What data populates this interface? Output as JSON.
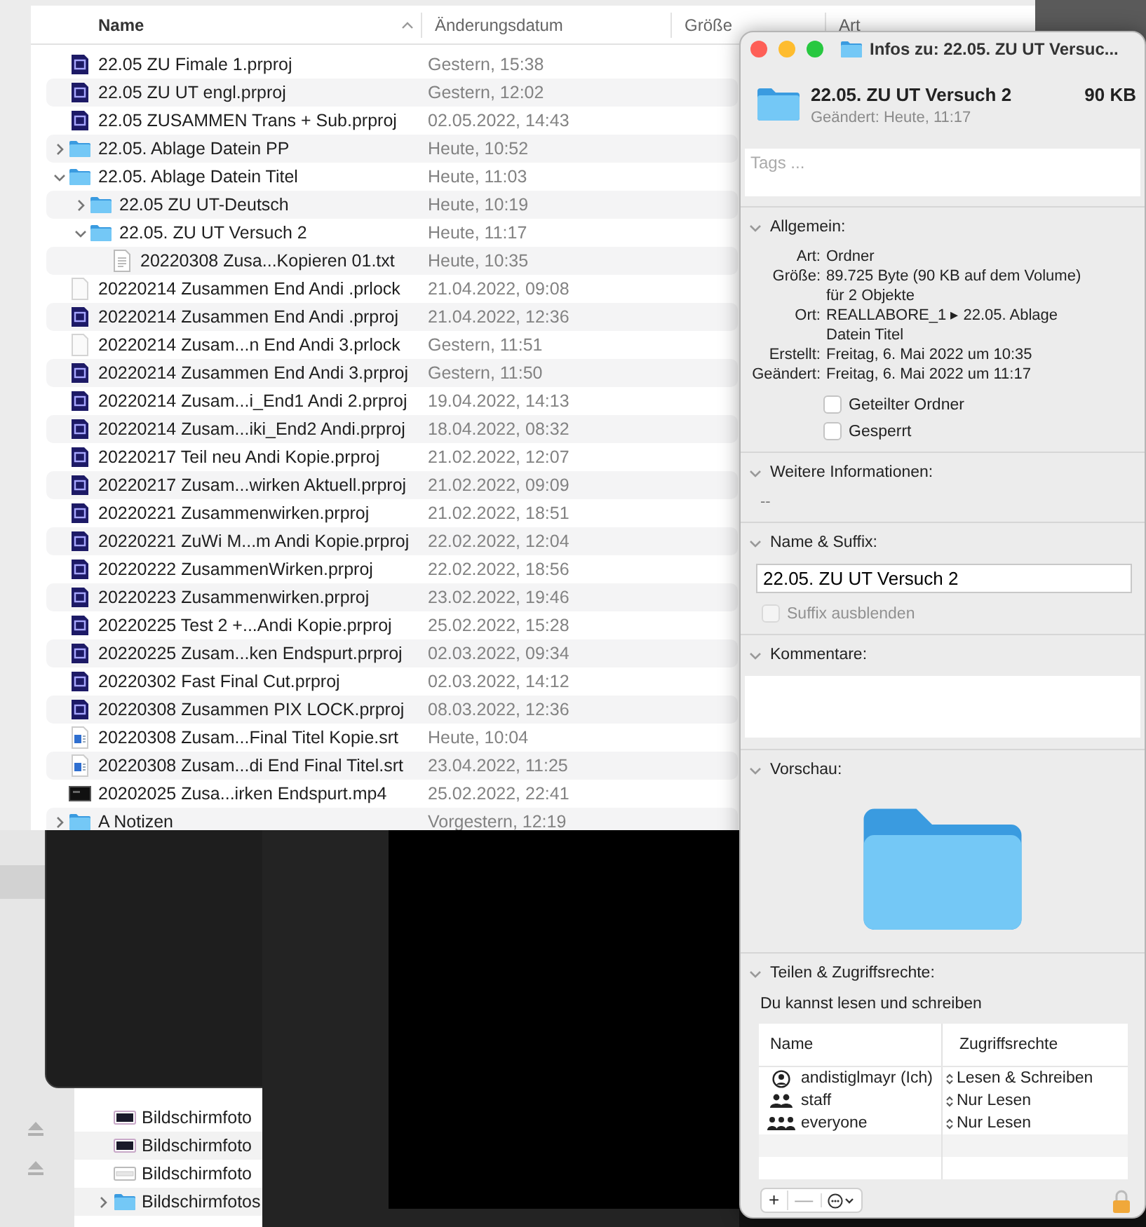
{
  "finder": {
    "columns": [
      {
        "label": "Name",
        "sorted": true
      },
      {
        "label": "Änderungsdatum",
        "sorted": false
      },
      {
        "label": "Größe",
        "sorted": false
      },
      {
        "label": "Art",
        "sorted": false
      }
    ],
    "files": [
      {
        "name": "22.05 ZU Fimale 1.prproj",
        "date": "Gestern, 15:38",
        "kind": "premiere"
      },
      {
        "name": "22.05 ZU UT engl.prproj",
        "date": "Gestern, 12:02",
        "kind": "premiere"
      },
      {
        "name": "22.05 ZUSAMMEN Trans + Sub.prproj",
        "date": "02.05.2022, 14:43",
        "kind": "premiere"
      },
      {
        "name": "22.05. Ablage Datein PP",
        "date": "Heute, 10:52",
        "kind": "folder",
        "expanded": false
      },
      {
        "name": "22.05. Ablage Datein Titel",
        "date": "Heute, 11:03",
        "kind": "folder",
        "expanded": true,
        "children": [
          {
            "name": "22.05 ZU UT-Deutsch",
            "date": "Heute, 10:19",
            "kind": "folder",
            "expanded": false
          },
          {
            "name": "22.05. ZU UT Versuch 2",
            "date": "Heute, 11:17",
            "kind": "folder",
            "expanded": true,
            "children": [
              {
                "name": "20220308 Zusa...Kopieren 01.txt",
                "date": "Heute, 10:35",
                "kind": "text"
              }
            ]
          }
        ]
      },
      {
        "name": "20220214 Zusammen End Andi .prlock",
        "date": "21.04.2022, 09:08",
        "kind": "lock"
      },
      {
        "name": "20220214 Zusammen End Andi .prproj",
        "date": "21.04.2022, 12:36",
        "kind": "premiere"
      },
      {
        "name": "20220214 Zusam...n End Andi 3.prlock",
        "date": "Gestern, 11:51",
        "kind": "lock"
      },
      {
        "name": "20220214 Zusammen End Andi 3.prproj",
        "date": "Gestern, 11:50",
        "kind": "premiere"
      },
      {
        "name": "20220214 Zusam...i_End1 Andi 2.prproj",
        "date": "19.04.2022, 14:13",
        "kind": "premiere"
      },
      {
        "name": "20220214 Zusam...iki_End2 Andi.prproj",
        "date": "18.04.2022, 08:32",
        "kind": "premiere"
      },
      {
        "name": "20220217 Teil neu Andi Kopie.prproj",
        "date": "21.02.2022, 12:07",
        "kind": "premiere"
      },
      {
        "name": "20220217 Zusam...wirken Aktuell.prproj",
        "date": "21.02.2022, 09:09",
        "kind": "premiere"
      },
      {
        "name": "20220221 Zusammenwirken.prproj",
        "date": "21.02.2022, 18:51",
        "kind": "premiere"
      },
      {
        "name": "20220221 ZuWi M...m Andi Kopie.prproj",
        "date": "22.02.2022, 12:04",
        "kind": "premiere"
      },
      {
        "name": "20220222 ZusammenWirken.prproj",
        "date": "22.02.2022, 18:56",
        "kind": "premiere"
      },
      {
        "name": "20220223 Zusammenwirken.prproj",
        "date": "23.02.2022, 19:46",
        "kind": "premiere"
      },
      {
        "name": "20220225 Test 2 +...Andi Kopie.prproj",
        "date": "25.02.2022, 15:28",
        "kind": "premiere"
      },
      {
        "name": "20220225 Zusam...ken Endspurt.prproj",
        "date": "02.03.2022, 09:34",
        "kind": "premiere"
      },
      {
        "name": "20220302 Fast Final Cut.prproj",
        "date": "02.03.2022, 14:12",
        "kind": "premiere"
      },
      {
        "name": "20220308 Zusammen PIX LOCK.prproj",
        "date": "08.03.2022, 12:36",
        "kind": "premiere"
      },
      {
        "name": "20220308 Zusam...Final Titel Kopie.srt",
        "date": "Heute, 10:04",
        "kind": "subtitle"
      },
      {
        "name": "20220308 Zusam...di End Final Titel.srt",
        "date": "23.04.2022, 11:25",
        "kind": "subtitle"
      },
      {
        "name": "20202025 Zusa...irken Endspurt.mp4",
        "date": "25.02.2022, 22:41",
        "kind": "video"
      },
      {
        "name": "A Notizen",
        "date": "Vorgestern, 12:19",
        "kind": "folder",
        "expanded": false
      }
    ]
  },
  "back_finder": {
    "files": [
      {
        "name": "Bildschirmfoto",
        "kind": "photo"
      },
      {
        "name": "Bildschirmfoto",
        "kind": "photo"
      },
      {
        "name": "Bildschirmfoto",
        "kind": "sheet"
      },
      {
        "name": "Bildschirmfotos",
        "kind": "folder",
        "expanded": false
      }
    ]
  },
  "info": {
    "title": "Infos zu: 22.05. ZU UT Versuc...",
    "name": "22.05. ZU UT Versuch 2",
    "size": "90 KB",
    "modified": "Geändert: Heute, 11:17",
    "tags": {
      "placeholder": "Tags ..."
    },
    "sections": [
      {
        "kind": "general",
        "title": "Allgemein:",
        "expanded": true,
        "rows": [
          {
            "label": "Art:",
            "lines": [
              "Ordner"
            ]
          },
          {
            "label": "Größe:",
            "lines": [
              "89.725 Byte (90 KB auf dem Volume)",
              "für 2 Objekte"
            ]
          },
          {
            "label": "Ort:",
            "lines": [
              "REALLABORE_1 ▸ 22.05. Ablage",
              "Datein Titel"
            ]
          },
          {
            "label": "Erstellt:",
            "lines": [
              "Freitag, 6. Mai 2022 um 10:35"
            ]
          },
          {
            "label": "Geändert:",
            "lines": [
              "Freitag, 6. Mai 2022 um 11:17"
            ]
          }
        ],
        "options": [
          {
            "label": "Geteilter Ordner",
            "checked": false
          },
          {
            "label": "Gesperrt",
            "checked": false
          }
        ]
      },
      {
        "kind": "more",
        "title": "Weitere Informationen:",
        "expanded": true,
        "text": "--"
      },
      {
        "kind": "name",
        "title": "Name & Suffix:",
        "expanded": true,
        "value": "22.05. ZU UT Versuch 2",
        "option": {
          "label": "Suffix ausblenden",
          "checked": false,
          "disabled": true
        }
      },
      {
        "kind": "comments",
        "title": "Kommentare:",
        "expanded": true
      },
      {
        "kind": "preview",
        "title": "Vorschau:",
        "expanded": true
      },
      {
        "kind": "sharing",
        "title": "Teilen & Zugriffsrechte:",
        "expanded": true,
        "note": "Du kannst lesen und schreiben",
        "columns": [
          "Name",
          "Zugriffsrechte"
        ],
        "rows": [
          {
            "kind": "user",
            "name": "andistiglmayr (Ich)",
            "access": "Lesen & Schreiben"
          },
          {
            "kind": "group",
            "name": "staff",
            "access": "Nur Lesen"
          },
          {
            "kind": "everyone",
            "name": "everyone",
            "access": "Nur Lesen"
          }
        ],
        "buttons": [
          "+",
          "—"
        ]
      }
    ]
  }
}
